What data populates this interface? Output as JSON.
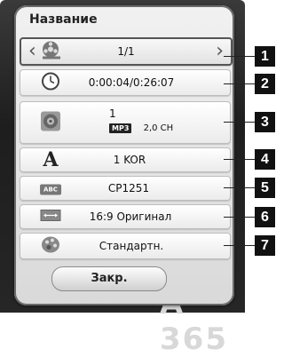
{
  "panel": {
    "title": "Название"
  },
  "rows": {
    "title_nav": "1/1",
    "time": "0:00:04/0:26:07",
    "audio": {
      "track": "1",
      "codec": "MP3",
      "channels": "2,0 CH"
    },
    "subtitle_lang": "1 KOR",
    "code_page": "CP1251",
    "aspect": "16:9 Оригинал",
    "picture_mode": "Стандартн."
  },
  "icons": {
    "reel": "film-reel-icon",
    "clock": "clock-icon",
    "speaker": "speaker-icon",
    "font": "letter-a-icon",
    "abc": "abc-subtitle-icon",
    "aspect": "aspect-ratio-icon",
    "picture": "picture-mode-icon"
  },
  "abc_label": "ABC",
  "font_glyph": "A",
  "callouts": [
    "1",
    "2",
    "3",
    "4",
    "5",
    "6",
    "7"
  ],
  "buttons": {
    "close": "Закр."
  },
  "backdrop_text": "A  365"
}
